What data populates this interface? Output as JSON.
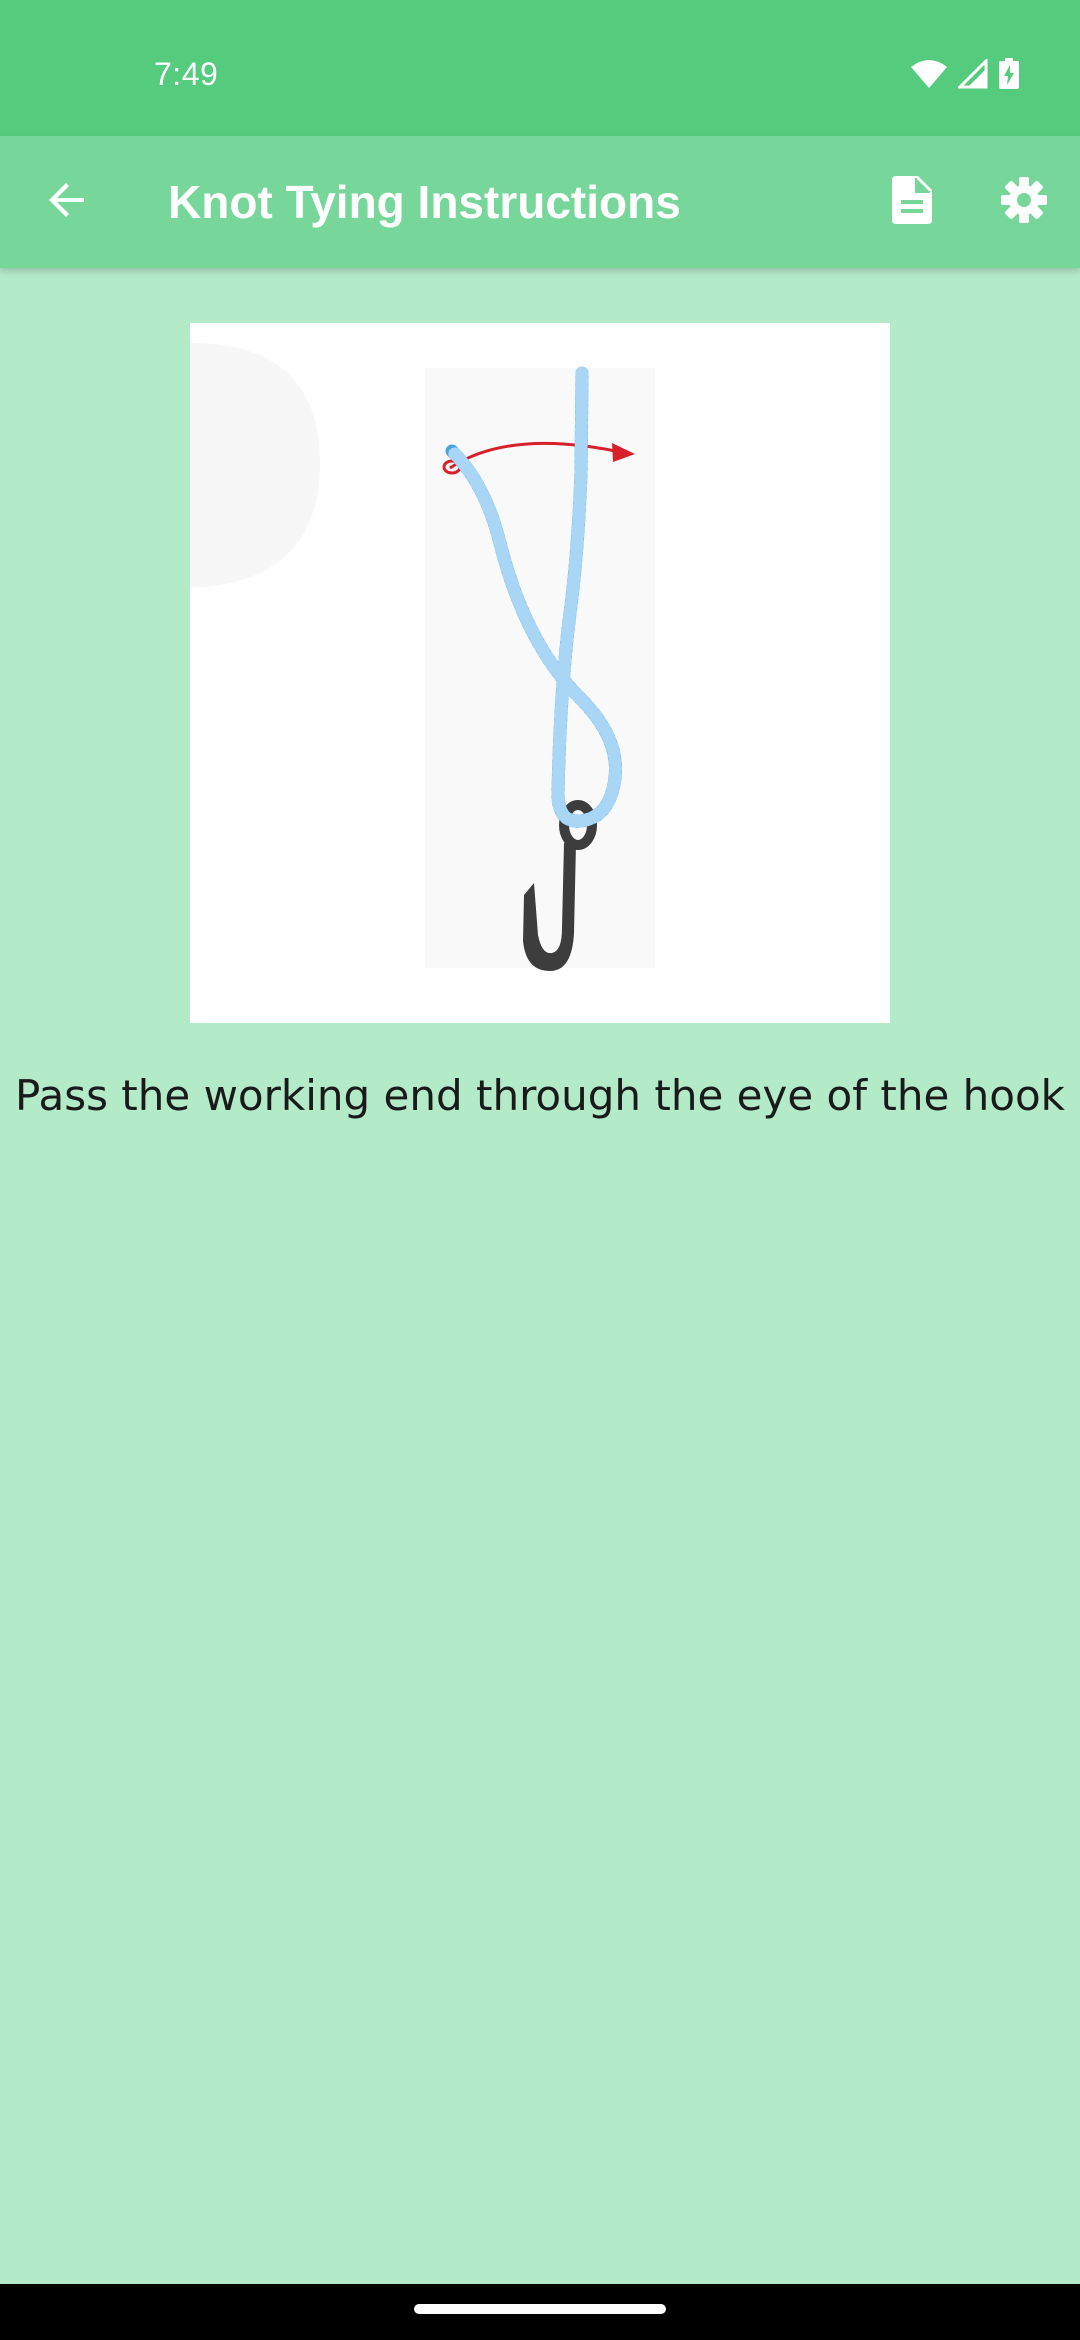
{
  "status_bar": {
    "time": "7:49",
    "icons": [
      "wifi-icon",
      "cellular-signal-icon",
      "battery-charging-icon"
    ],
    "color": "#54cb7d"
  },
  "app_bar": {
    "title": "Knot Tying Instructions",
    "back_icon": "arrow-back-icon",
    "actions": [
      "document-icon",
      "settings-gear-icon"
    ],
    "color": "#77d79a"
  },
  "content": {
    "background": "#b3eac8",
    "image": "knot-step-illustration",
    "instruction": "Pass the working end through the eye of the hook"
  }
}
